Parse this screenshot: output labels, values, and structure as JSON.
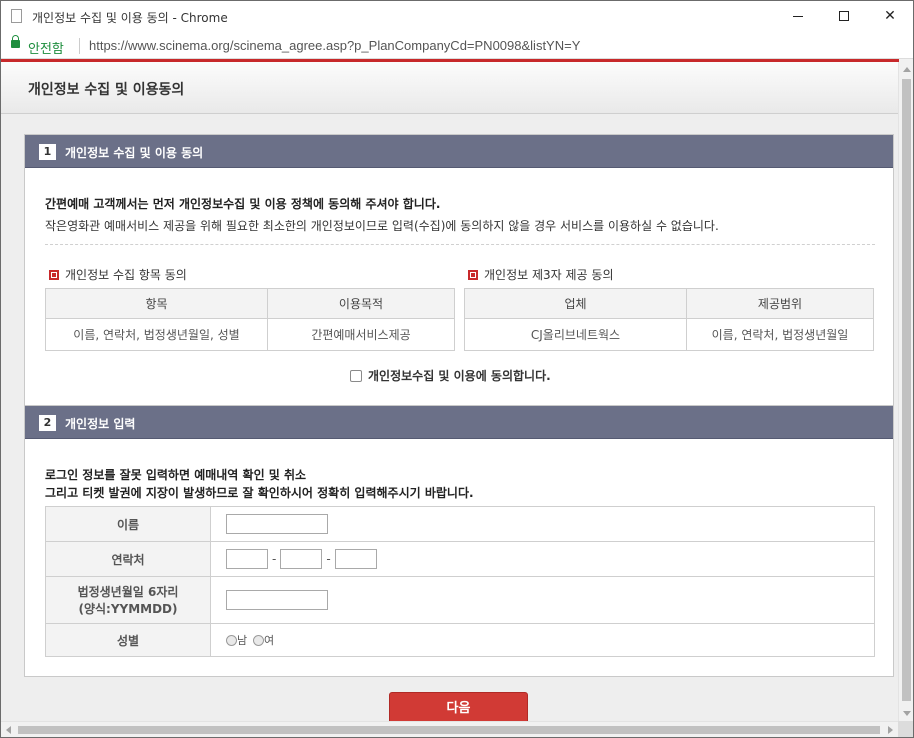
{
  "window": {
    "title": "개인정보 수집 및 이용 동의 - Chrome"
  },
  "address_bar": {
    "secure_label": "안전함",
    "url": "https://www.scinema.org/scinema_agree.asp?p_PlanCompanyCd=PN0098&listYN=Y"
  },
  "popup": {
    "title": "개인정보 수집 및 이용동의"
  },
  "section1": {
    "number": "1",
    "title": "개인정보 수집 및 이용 동의",
    "intro_bold": "간편예매 고객께서는 먼저 개인정보수집 및 이용 정책에 동의해 주셔야 합니다.",
    "intro": "작은영화관 예매서비스 제공을 위해 필요한 최소한의 개인정보이므로 입력(수집)에 동의하지 않을 경우 서비스를 이용하실 수 없습니다.",
    "collect_table": {
      "heading": "개인정보 수집 항목 동의",
      "headers": [
        "항목",
        "이용목적"
      ],
      "row": [
        "이름, 연락처, 법정생년월일, 성별",
        "간편예매서비스제공"
      ]
    },
    "third_party_table": {
      "heading": "개인정보 제3자 제공 동의",
      "headers": [
        "업체",
        "제공범위"
      ],
      "row": [
        "CJ올리브네트웍스",
        "이름, 연락처, 법정생년월일"
      ]
    },
    "agree_label": "개인정보수집 및 이용에 동의합니다."
  },
  "section2": {
    "number": "2",
    "title": "개인정보 입력",
    "notice_line1": "로그인 정보를 잘못 입력하면 예매내역 확인 및 취소",
    "notice_line2": "그리고 티켓 발권에 지장이 발생하므로 잘 확인하시어 정확히 입력해주시기 바랍니다.",
    "fields": {
      "name_label": "이름",
      "phone_label": "연락처",
      "birth_label_line1": "법정생년월일 6자리",
      "birth_label_line2": "(양식:YYMMDD)",
      "gender_label": "성별",
      "gender_male": "남",
      "gender_female": "여",
      "dash": "-"
    }
  },
  "next_button": {
    "label": "다음"
  }
}
